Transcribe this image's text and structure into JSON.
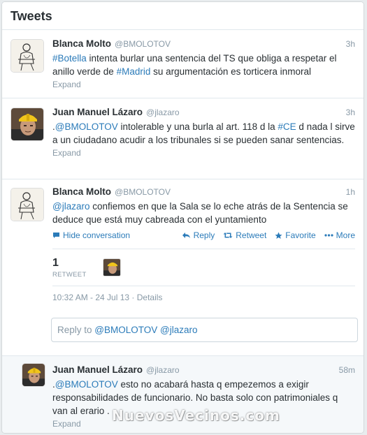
{
  "header": {
    "title": "Tweets"
  },
  "tweets": [
    {
      "name": "Blanca Molto",
      "handle": "@BMOLOTOV",
      "time": "3h",
      "text_parts": [
        "#Botella",
        " intenta burlar una sentencia del TS que obliga a respetar el anillo verde de ",
        "#Madrid",
        "  su argumentación es torticera inmoral"
      ],
      "expand": "Expand"
    },
    {
      "name": "Juan Manuel Lázaro",
      "handle": "@jlazaro",
      "time": "3h",
      "text_parts": [
        ".",
        "@BMOLOTOV",
        " intolerable y una burla al art. 118 d la ",
        "#CE",
        " d nada l sirve a un ciudadano acudir a los tribunales si se pueden sanar sentencias."
      ],
      "expand": "Expand"
    },
    {
      "name": "Blanca Molto",
      "handle": "@BMOLOTOV",
      "time": "1h",
      "text_parts": [
        "@jlazaro",
        " confiemos en que la Sala se lo eche atrás de la Sentencia se deduce que está muy cabreada con el yuntamiento"
      ],
      "actions": {
        "hide": "Hide conversation",
        "reply": "Reply",
        "retweet": "Retweet",
        "favorite": "Favorite",
        "more": "More"
      },
      "stats": {
        "count": "1",
        "label": "RETWEET"
      },
      "meta": "10:32 AM - 24 Jul 13 · Details",
      "reply_box": {
        "prefix": "Reply to ",
        "mentions": "@BMOLOTOV @jlazaro"
      }
    },
    {
      "name": "Juan Manuel Lázaro",
      "handle": "@jlazaro",
      "time": "58m",
      "text_parts": [
        ".",
        "@BMOLOTOV",
        " esto no acabará hasta q empezemos a exigir responsabilidades de funcionario.  No basta solo con patrimoniales q van al erario ."
      ],
      "expand": "Expand"
    }
  ],
  "watermark": "NuevosVecinos.com",
  "colors": {
    "link": "#2b7bb9",
    "muted": "#8899a6",
    "text": "#292f33",
    "reply_bg": "#f5f8fa"
  }
}
